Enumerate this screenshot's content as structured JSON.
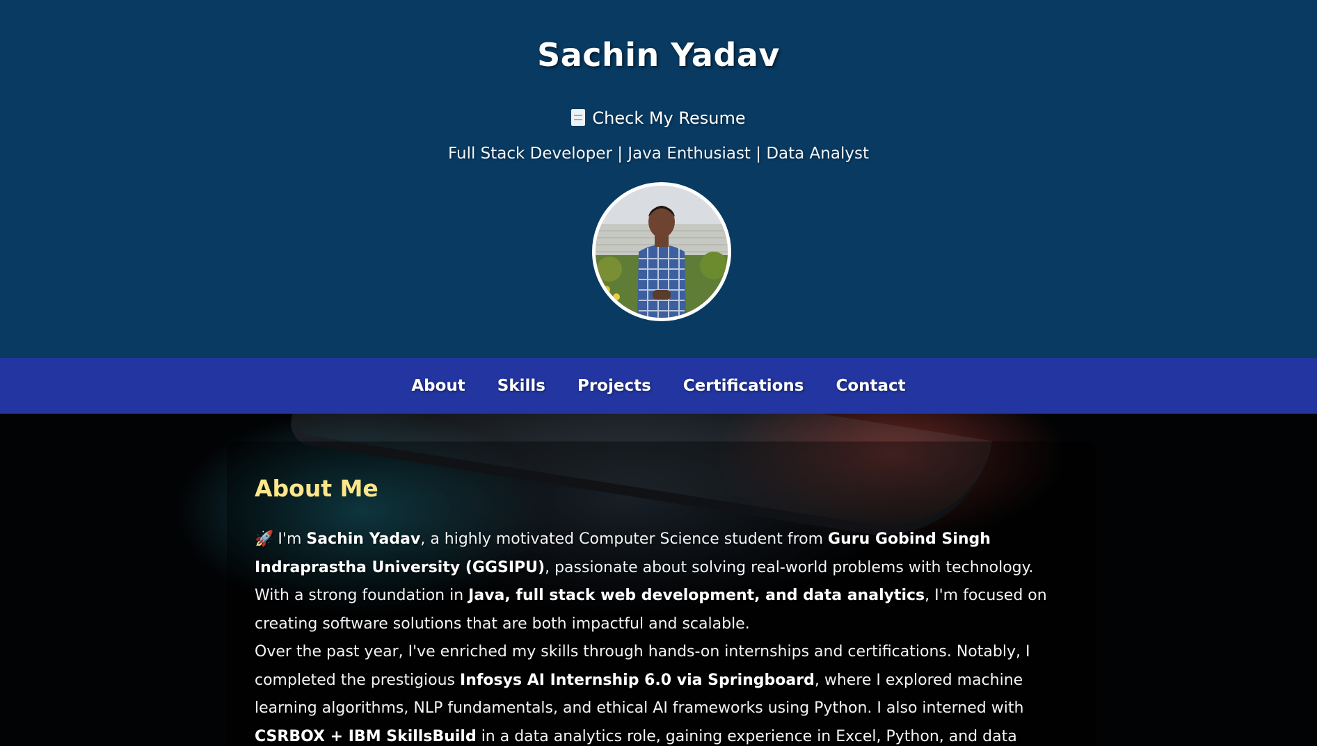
{
  "header": {
    "title": "Sachin Yadav",
    "resume_icon": "document-icon",
    "resume_label": "Check My Resume",
    "tagline": "Full Stack Developer | Java Enthusiast | Data Analyst",
    "avatar_alt": "Sachin Yadav",
    "background_color": "#083a62"
  },
  "nav": {
    "items": [
      {
        "label": "About"
      },
      {
        "label": "Skills"
      },
      {
        "label": "Projects"
      },
      {
        "label": "Certifications"
      },
      {
        "label": "Contact"
      }
    ],
    "background_color": "#2335a0"
  },
  "about": {
    "title": "About Me",
    "title_color": "#fde68a",
    "rocket_icon": "🚀",
    "p1": {
      "t1": "I'm ",
      "b1": "Sachin Yadav",
      "t2": ", a highly motivated Computer Science student from ",
      "b2": "Guru Gobind Singh Indraprastha University (GGSIPU)",
      "t3": ", passionate about solving real-world problems with technology. With a strong foundation in ",
      "b3": "Java, full stack web development, and data analytics",
      "t4": ", I'm focused on creating software solutions that are both impactful and scalable."
    },
    "p2": {
      "t1": "Over the past year, I've enriched my skills through hands-on internships and certifications. Notably, I completed the prestigious ",
      "b1": "Infosys AI Internship 6.0 via Springboard",
      "t2": ", where I explored machine learning algorithms, NLP fundamentals, and ethical AI frameworks using Python. I also interned with ",
      "b2": "CSRBOX + IBM SkillsBuild",
      "t3": " in a data analytics role, gaining experience in Excel, Python, and data visualization tools to"
    }
  }
}
